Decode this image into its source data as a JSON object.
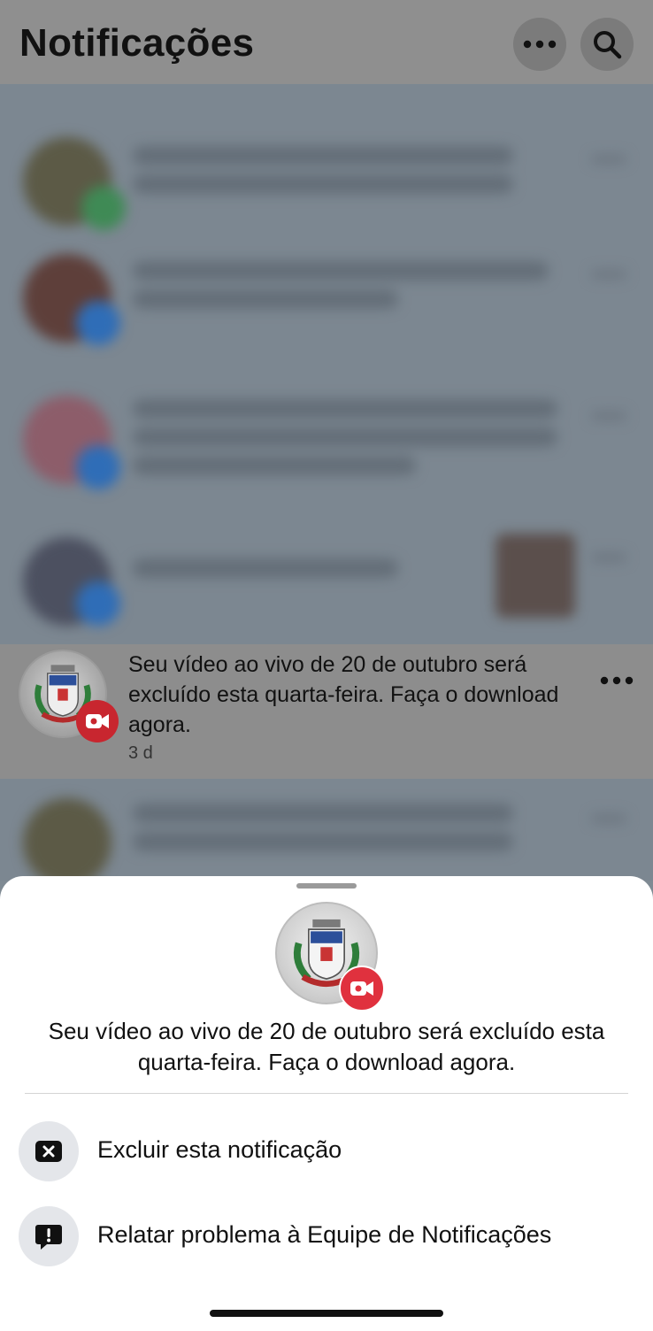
{
  "header": {
    "title": "Notificações",
    "more_icon": "ellipsis-icon",
    "search_icon": "search-icon"
  },
  "highlighted_notification": {
    "text": "Seu vídeo ao vivo de 20 de outubro será excluído esta quarta-feira. Faça o download agora.",
    "time": "3 d",
    "badge_icon": "live-video-icon"
  },
  "sheet": {
    "message": "Seu vídeo ao vivo de 20 de outubro será excluído esta quarta-feira. Faça o download agora.",
    "options": [
      {
        "label": "Excluir esta notificação",
        "icon": "close-box-icon"
      },
      {
        "label": "Relatar problema à Equipe de Notificações",
        "icon": "report-icon"
      }
    ]
  },
  "colors": {
    "live_badge": "#e0313e",
    "option_icon_bg": "#e4e6ea"
  }
}
